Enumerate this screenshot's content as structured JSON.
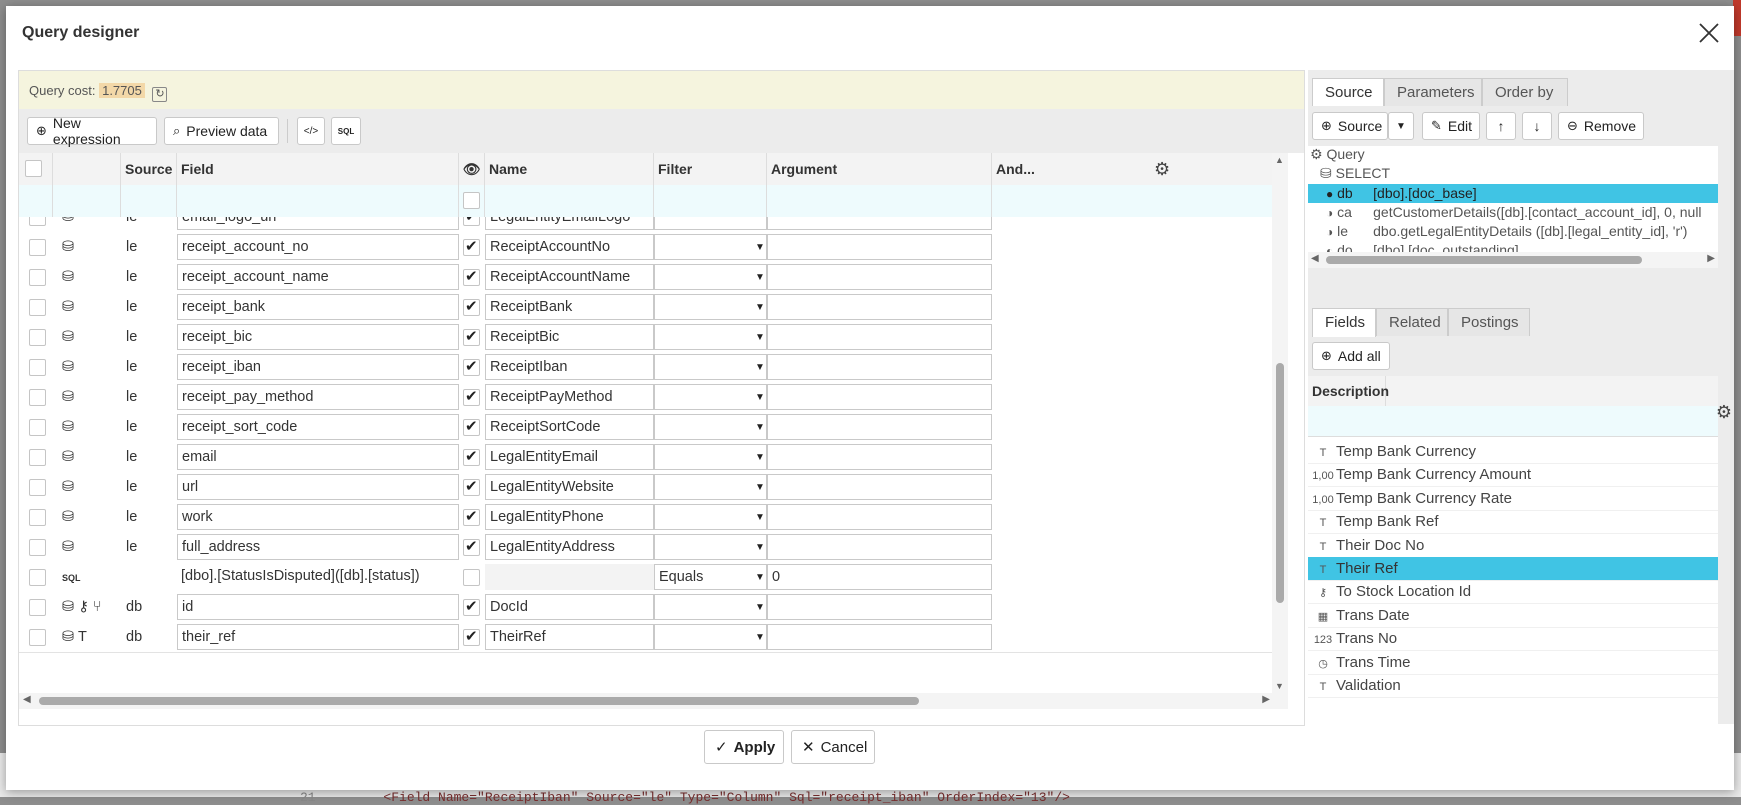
{
  "dialog": {
    "title": "Query designer",
    "apply_label": "Apply",
    "cancel_label": "Cancel"
  },
  "cost": {
    "label": "Query cost:",
    "value": "1.7705"
  },
  "toolbar": {
    "new_expression": "New expression",
    "preview_data": "Preview data",
    "sql_label": "SQL",
    "code_label": "</>"
  },
  "grid": {
    "columns": [
      "Source",
      "Field",
      "Name",
      "Filter",
      "Argument",
      "And..."
    ],
    "partial_row": {
      "source": "le",
      "field": "email_logo_url",
      "name": "LegalEntityEmailLogo"
    },
    "rows": [
      {
        "source": "le",
        "field": "receipt_account_no",
        "name": "ReceiptAccountNo",
        "filter": "",
        "argument": "",
        "visible": true
      },
      {
        "source": "le",
        "field": "receipt_account_name",
        "name": "ReceiptAccountName",
        "filter": "",
        "argument": "",
        "visible": true
      },
      {
        "source": "le",
        "field": "receipt_bank",
        "name": "ReceiptBank",
        "filter": "",
        "argument": "",
        "visible": true
      },
      {
        "source": "le",
        "field": "receipt_bic",
        "name": "ReceiptBic",
        "filter": "",
        "argument": "",
        "visible": true
      },
      {
        "source": "le",
        "field": "receipt_iban",
        "name": "ReceiptIban",
        "filter": "",
        "argument": "",
        "visible": true
      },
      {
        "source": "le",
        "field": "receipt_pay_method",
        "name": "ReceiptPayMethod",
        "filter": "",
        "argument": "",
        "visible": true
      },
      {
        "source": "le",
        "field": "receipt_sort_code",
        "name": "ReceiptSortCode",
        "filter": "",
        "argument": "",
        "visible": true
      },
      {
        "source": "le",
        "field": "email",
        "name": "LegalEntityEmail",
        "filter": "",
        "argument": "",
        "visible": true
      },
      {
        "source": "le",
        "field": "url",
        "name": "LegalEntityWebsite",
        "filter": "",
        "argument": "",
        "visible": true
      },
      {
        "source": "le",
        "field": "work",
        "name": "LegalEntityPhone",
        "filter": "",
        "argument": "",
        "visible": true
      },
      {
        "source": "le",
        "field": "full_address",
        "name": "LegalEntityAddress",
        "filter": "",
        "argument": "",
        "visible": true
      },
      {
        "source": "",
        "field": "[dbo].[StatusIsDisputed]([db].[status])",
        "name": "",
        "filter": "Equals",
        "argument": "0",
        "visible": false,
        "sql": true
      },
      {
        "source": "db",
        "field": "id",
        "name": "DocId",
        "filter": "",
        "argument": "",
        "visible": true,
        "key": true
      },
      {
        "source": "db",
        "field": "their_ref",
        "name": "TheirRef",
        "filter": "",
        "argument": "",
        "visible": true,
        "text": true
      }
    ]
  },
  "right": {
    "tabs": [
      "Source",
      "Parameters",
      "Order by"
    ],
    "source_btn": "Source",
    "edit_btn": "Edit",
    "remove_btn": "Remove",
    "tree": {
      "root": "Query",
      "select": "SELECT",
      "items": [
        {
          "alias": "db",
          "expr": "[dbo].[doc_base]",
          "selected": true
        },
        {
          "alias": "ca",
          "expr": "getCustomerDetails([db].[contact_account_id], 0, null"
        },
        {
          "alias": "le",
          "expr": "dbo.getLegalEntityDetails ([db].[legal_entity_id], 'r')"
        },
        {
          "alias": "do",
          "expr": "[dbo].[doc_outstanding]"
        }
      ]
    },
    "field_tabs": [
      "Fields",
      "Related",
      "Postings"
    ],
    "add_all": "Add all",
    "description_header": "Description",
    "fields": [
      {
        "icon": "T",
        "label": "Temp Bank Currency"
      },
      {
        "icon": "1,00",
        "label": "Temp Bank Currency Amount"
      },
      {
        "icon": "1,00",
        "label": "Temp Bank Currency Rate"
      },
      {
        "icon": "T",
        "label": "Temp Bank Ref"
      },
      {
        "icon": "T",
        "label": "Their Doc No"
      },
      {
        "icon": "T",
        "label": "Their Ref",
        "selected": true
      },
      {
        "icon": "key",
        "label": "To Stock Location Id"
      },
      {
        "icon": "cal",
        "label": "Trans Date"
      },
      {
        "icon": "123",
        "label": "Trans No"
      },
      {
        "icon": "clock",
        "label": "Trans Time"
      },
      {
        "icon": "T",
        "label": "Validation"
      }
    ]
  },
  "background": {
    "line_no": "21",
    "code": "<Field Name=\"ReceiptIban\" Source=\"le\" Type=\"Column\" Sql=\"receipt_iban\" OrderIndex=\"13\"/>"
  },
  "colors": {
    "selection": "#40c4e4",
    "costbar": "#f5f4de",
    "filterrow": "#eefbfd"
  }
}
